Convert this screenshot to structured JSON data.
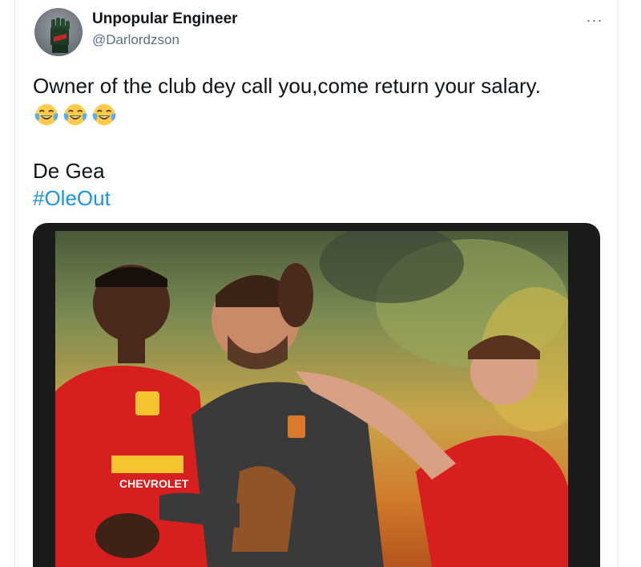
{
  "tweet": {
    "author_name": "Unpopular Engineer",
    "author_handle": "@Darlordzson",
    "more_label": "···",
    "text": "Owner of the club dey call you,come return your salary.",
    "emojis": [
      "face-with-tears-of-joy",
      "face-with-tears-of-joy",
      "face-with-tears-of-joy"
    ],
    "detail": "De Gea",
    "hashtag": "#OleOut"
  },
  "image": {
    "sponsor_text": "CHEVROLET"
  },
  "colors": {
    "link": "#1b95e0",
    "secondary_text": "#5b7083",
    "jersey_red": "#d81f1f",
    "keeper_kit": "#3a3a3a"
  }
}
